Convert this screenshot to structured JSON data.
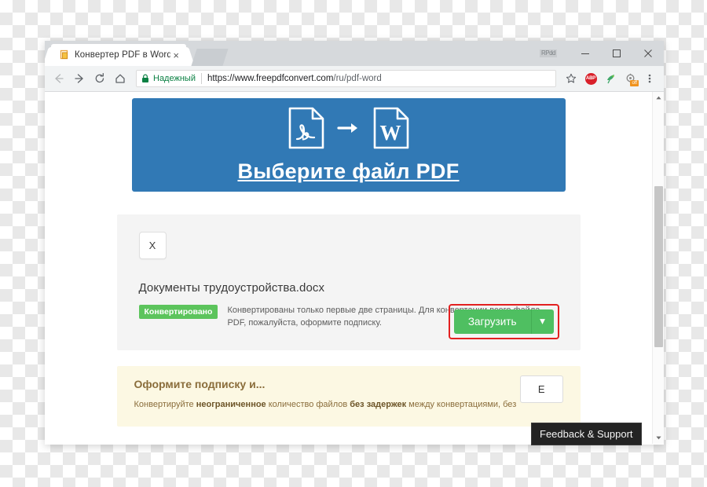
{
  "window": {
    "user_badge": "RPdd",
    "minimize_label": "Minimize",
    "maximize_label": "Maximize",
    "close_label": "Close"
  },
  "tab": {
    "title": "Конвертер PDF в Word -",
    "close_label": "×",
    "favicon": "pdf-document-icon"
  },
  "toolbar": {
    "back_label": "Back",
    "forward_label": "Forward",
    "reload_label": "Reload",
    "home_label": "Home",
    "secure_label": "Надежный",
    "url_domain": "https://www.freepdfconvert.com",
    "url_path": "/ru/pdf-word",
    "bookmark_label": "Bookmark",
    "abp_label": "ABP",
    "extension_badge": "off",
    "menu_label": "Menu"
  },
  "hero": {
    "link_text": "Выберите файл PDF",
    "source_format": "PDF",
    "target_format": "W"
  },
  "file_card": {
    "remove_label": "X",
    "file_name": "Документы трудоустройства.docx",
    "badge": "Конвертировано",
    "status_text": "Конвертированы только первые две страницы. Для конвертации всего файла PDF, пожалуйста, оформите подписку.",
    "download_label": "Загрузить",
    "download_caret": "▾"
  },
  "promo": {
    "title": "Оформите подписку и...",
    "body_part1": "Конвертируйте ",
    "body_bold1": "неограниченное",
    "body_part2": " количество файлов ",
    "body_bold2": "без задержек",
    "body_part3": " между конвертациями, без",
    "button_label": "Е"
  },
  "tooltip": {
    "text": "Feedback & Support"
  },
  "colors": {
    "hero_blue": "#3179b5",
    "badge_green": "#5cc45c",
    "download_green": "#4fbf61",
    "highlight_red": "#e32020",
    "promo_yellow": "#fcf8e3",
    "secure_green": "#0b8043"
  }
}
